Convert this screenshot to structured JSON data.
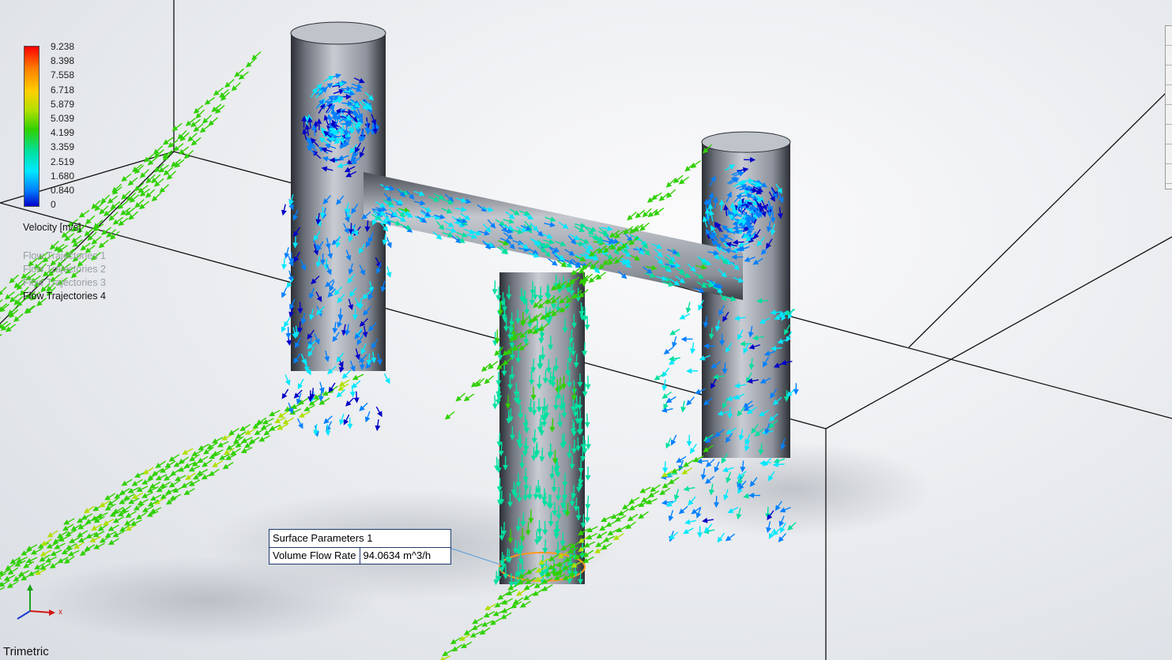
{
  "legend": {
    "ticks": [
      "9.238",
      "8.398",
      "7.558",
      "6.718",
      "5.879",
      "5.039",
      "4.199",
      "3.359",
      "2.519",
      "1.680",
      "0.840",
      "0"
    ],
    "title": "Velocity [m/s]",
    "max": 9.238,
    "min": 0,
    "colormap": [
      "#ff0000",
      "#ff8000",
      "#ffd000",
      "#b0e000",
      "#30d000",
      "#00e0a0",
      "#00e8ff",
      "#0080ff",
      "#0000c8"
    ]
  },
  "trajectories": {
    "items": [
      "Flow Trajectories 1",
      "Flow Trajectories 2",
      "Flow Trajectories 3",
      "Flow Trajectories 4"
    ],
    "active_index": 3
  },
  "surface_parameters": {
    "title": "Surface Parameters 1",
    "param_label": "Volume Flow Rate",
    "param_value": "94.0634 m^3/h"
  },
  "view": {
    "label": "Trimetric"
  },
  "triad": {
    "x_label": "x"
  },
  "colors": {
    "pipe_fill": "#a9aeb8",
    "pipe_dark": "#2c2f36",
    "table_border": "#1f3a6e",
    "highlight_edge": "#ff9a1a"
  }
}
